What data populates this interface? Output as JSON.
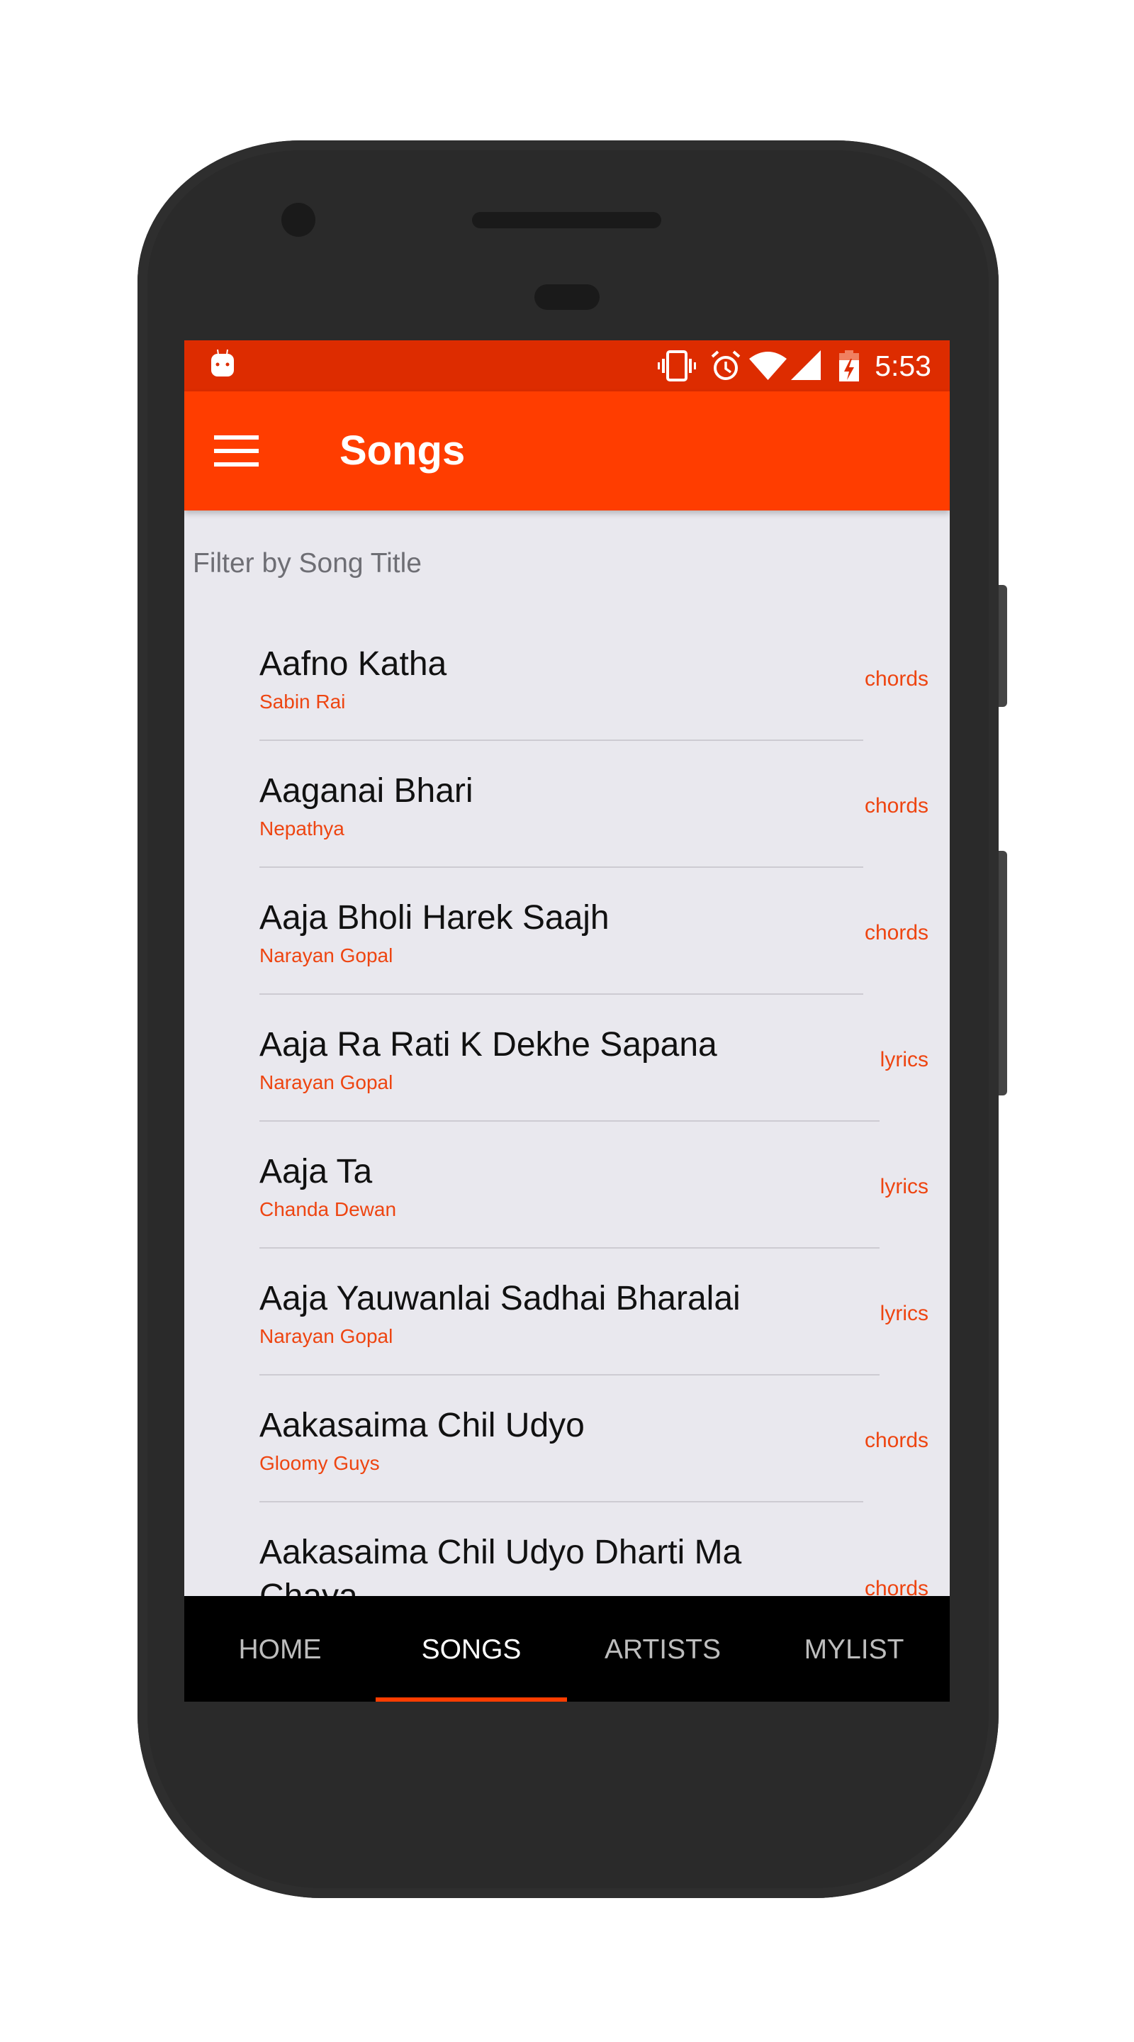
{
  "status_bar": {
    "notification_icon": "android-cupcake-icon",
    "icons": [
      "vibrate-icon",
      "alarm-icon",
      "wifi-icon",
      "signal-icon",
      "battery-charging-icon"
    ],
    "time": "5:53"
  },
  "app_bar": {
    "menu_icon": "hamburger-menu-icon",
    "title": "Songs"
  },
  "filter": {
    "placeholder": "Filter by Song Title",
    "value": ""
  },
  "songs": [
    {
      "title": "Aafno Katha",
      "artist": "Sabin Rai",
      "type": "chords"
    },
    {
      "title": "Aaganai Bhari",
      "artist": "Nepathya",
      "type": "chords"
    },
    {
      "title": "Aaja Bholi Harek Saajh",
      "artist": "Narayan Gopal",
      "type": "chords"
    },
    {
      "title": "Aaja Ra Rati K Dekhe Sapana",
      "artist": "Narayan Gopal",
      "type": "lyrics"
    },
    {
      "title": "Aaja Ta",
      "artist": "Chanda Dewan",
      "type": "lyrics"
    },
    {
      "title": "Aaja Yauwanlai Sadhai Bharalai",
      "artist": "Narayan Gopal",
      "type": "lyrics"
    },
    {
      "title": "Aakasaima Chil Udyo",
      "artist": "Gloomy Guys",
      "type": "chords"
    },
    {
      "title": "Aakasaima Chil Udyo Dharti Ma Chaya",
      "artist": "",
      "type": "chords"
    }
  ],
  "bottom_nav": {
    "tabs": [
      {
        "label": "HOME",
        "active": false
      },
      {
        "label": "SONGS",
        "active": true
      },
      {
        "label": "ARTISTS",
        "active": false
      },
      {
        "label": "MYLIST",
        "active": false
      }
    ]
  },
  "colors": {
    "primary": "#ff3d00",
    "primary_dark": "#dd2c00",
    "accent_text": "#ee4511",
    "list_background": "#e9e8ee",
    "nav_background": "#000000"
  }
}
